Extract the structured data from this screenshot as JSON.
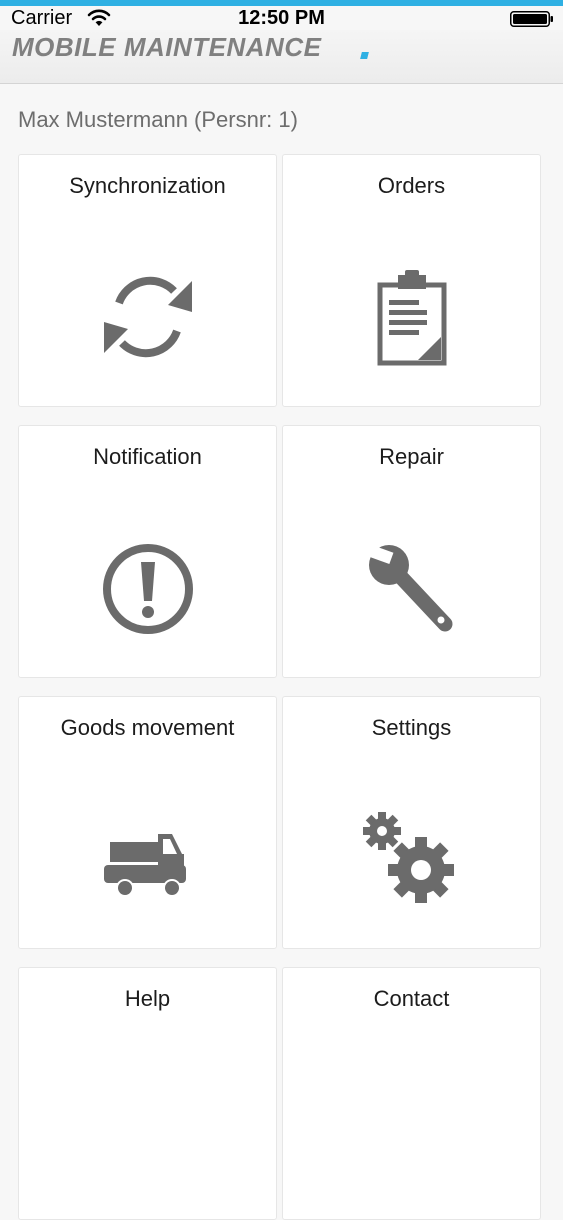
{
  "status_bar": {
    "carrier": "Carrier",
    "time": "12:50 PM",
    "wifi_icon": "wifi-icon",
    "battery_icon": "battery-icon"
  },
  "header": {
    "title": "MOBILE MAINTENANCE",
    "accent_color": "#2fb0e3"
  },
  "user": {
    "label": "Max Mustermann (Persnr: 1)"
  },
  "tiles": [
    {
      "label": "Synchronization",
      "icon": "sync-icon"
    },
    {
      "label": "Orders",
      "icon": "clipboard-icon"
    },
    {
      "label": "Notification",
      "icon": "alert-icon"
    },
    {
      "label": "Repair",
      "icon": "wrench-icon"
    },
    {
      "label": "Goods movement",
      "icon": "truck-icon"
    },
    {
      "label": "Settings",
      "icon": "gears-icon"
    },
    {
      "label": "Help",
      "icon": "help-icon"
    },
    {
      "label": "Contact",
      "icon": "contact-icon"
    }
  ],
  "colors": {
    "icon_gray": "#6b6b6b",
    "tile_background": "#ffffff",
    "page_background": "#f7f7f7"
  }
}
